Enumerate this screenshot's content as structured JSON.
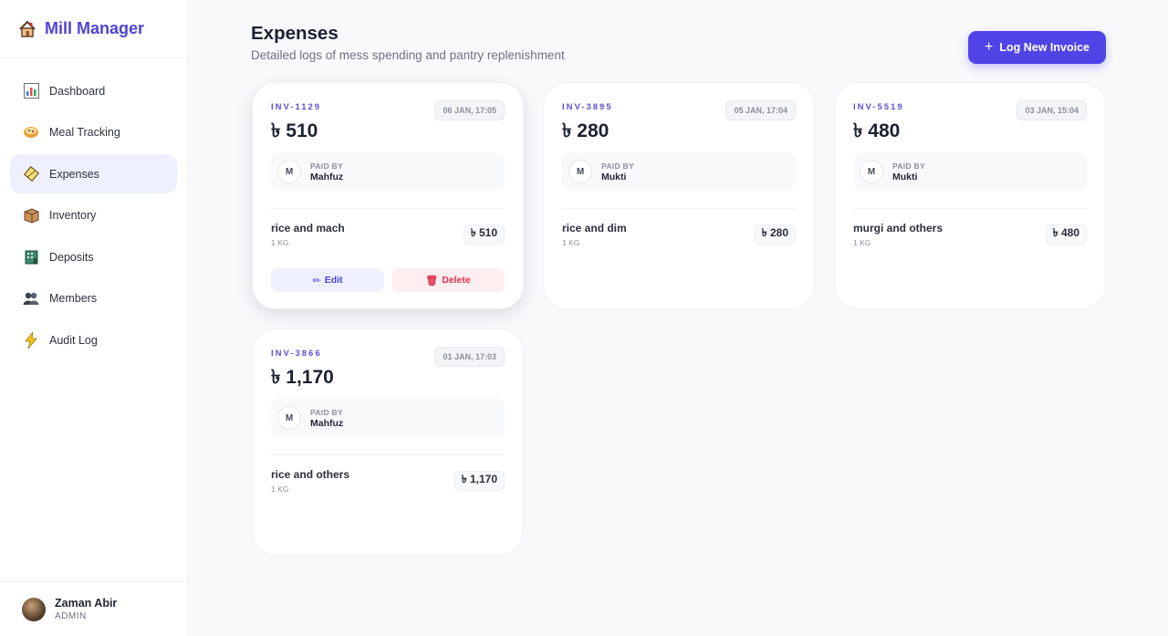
{
  "app": {
    "title": "Mill Manager"
  },
  "sidebar": {
    "items": [
      {
        "label": "Dashboard",
        "icon": "bar-chart-icon"
      },
      {
        "label": "Meal Tracking",
        "icon": "meal-bowl-icon"
      },
      {
        "label": "Expenses",
        "icon": "expenses-icon"
      },
      {
        "label": "Inventory",
        "icon": "box-icon"
      },
      {
        "label": "Deposits",
        "icon": "bank-icon"
      },
      {
        "label": "Members",
        "icon": "members-icon"
      },
      {
        "label": "Audit Log",
        "icon": "lightning-icon"
      }
    ],
    "active_index": 2
  },
  "user": {
    "name": "Zaman Abir",
    "role": "ADMIN"
  },
  "header": {
    "title": "Expenses",
    "subtitle": "Detailed logs of mess spending and pantry replenishment",
    "new_button": "Log New Invoice"
  },
  "labels": {
    "paid_by": "PAID BY",
    "edit": "Edit",
    "delete": "Delete"
  },
  "invoices": [
    {
      "id": "INV-1129",
      "date": "06 JAN, 17:05",
      "amount": "৳ 510",
      "payer_initial": "M",
      "payer": "Mahfuz",
      "item": "rice and mach",
      "qty": "1 KG",
      "item_amount": "৳ 510"
    },
    {
      "id": "INV-3895",
      "date": "05 JAN, 17:04",
      "amount": "৳ 280",
      "payer_initial": "M",
      "payer": "Mukti",
      "item": "rice and dim",
      "qty": "1 KG",
      "item_amount": "৳ 280"
    },
    {
      "id": "INV-5519",
      "date": "03 JAN, 15:04",
      "amount": "৳ 480",
      "payer_initial": "M",
      "payer": "Mukti",
      "item": "murgi and others",
      "qty": "1 KG",
      "item_amount": "৳ 480"
    },
    {
      "id": "INV-3866",
      "date": "01 JAN, 17:03",
      "amount": "৳ 1,170",
      "payer_initial": "M",
      "payer": "Mahfuz",
      "item": "rice and others",
      "qty": "1 KG",
      "item_amount": "৳ 1,170"
    }
  ],
  "colors": {
    "accent": "#5044e6",
    "danger": "#e0344f",
    "active_bg": "#eef1fd"
  }
}
